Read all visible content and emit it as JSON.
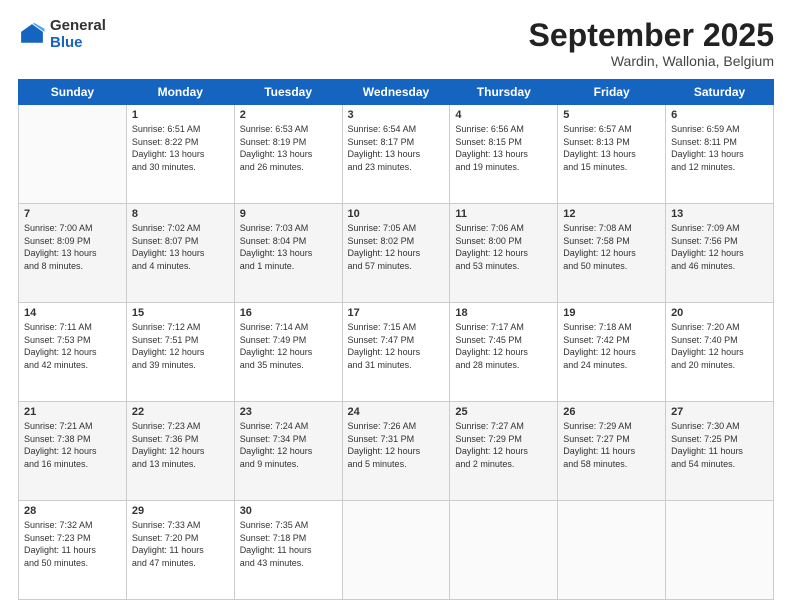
{
  "header": {
    "logo_general": "General",
    "logo_blue": "Blue",
    "month_title": "September 2025",
    "location": "Wardin, Wallonia, Belgium"
  },
  "days_of_week": [
    "Sunday",
    "Monday",
    "Tuesday",
    "Wednesday",
    "Thursday",
    "Friday",
    "Saturday"
  ],
  "weeks": [
    [
      {
        "day": "",
        "info": ""
      },
      {
        "day": "1",
        "info": "Sunrise: 6:51 AM\nSunset: 8:22 PM\nDaylight: 13 hours\nand 30 minutes."
      },
      {
        "day": "2",
        "info": "Sunrise: 6:53 AM\nSunset: 8:19 PM\nDaylight: 13 hours\nand 26 minutes."
      },
      {
        "day": "3",
        "info": "Sunrise: 6:54 AM\nSunset: 8:17 PM\nDaylight: 13 hours\nand 23 minutes."
      },
      {
        "day": "4",
        "info": "Sunrise: 6:56 AM\nSunset: 8:15 PM\nDaylight: 13 hours\nand 19 minutes."
      },
      {
        "day": "5",
        "info": "Sunrise: 6:57 AM\nSunset: 8:13 PM\nDaylight: 13 hours\nand 15 minutes."
      },
      {
        "day": "6",
        "info": "Sunrise: 6:59 AM\nSunset: 8:11 PM\nDaylight: 13 hours\nand 12 minutes."
      }
    ],
    [
      {
        "day": "7",
        "info": "Sunrise: 7:00 AM\nSunset: 8:09 PM\nDaylight: 13 hours\nand 8 minutes."
      },
      {
        "day": "8",
        "info": "Sunrise: 7:02 AM\nSunset: 8:07 PM\nDaylight: 13 hours\nand 4 minutes."
      },
      {
        "day": "9",
        "info": "Sunrise: 7:03 AM\nSunset: 8:04 PM\nDaylight: 13 hours\nand 1 minute."
      },
      {
        "day": "10",
        "info": "Sunrise: 7:05 AM\nSunset: 8:02 PM\nDaylight: 12 hours\nand 57 minutes."
      },
      {
        "day": "11",
        "info": "Sunrise: 7:06 AM\nSunset: 8:00 PM\nDaylight: 12 hours\nand 53 minutes."
      },
      {
        "day": "12",
        "info": "Sunrise: 7:08 AM\nSunset: 7:58 PM\nDaylight: 12 hours\nand 50 minutes."
      },
      {
        "day": "13",
        "info": "Sunrise: 7:09 AM\nSunset: 7:56 PM\nDaylight: 12 hours\nand 46 minutes."
      }
    ],
    [
      {
        "day": "14",
        "info": "Sunrise: 7:11 AM\nSunset: 7:53 PM\nDaylight: 12 hours\nand 42 minutes."
      },
      {
        "day": "15",
        "info": "Sunrise: 7:12 AM\nSunset: 7:51 PM\nDaylight: 12 hours\nand 39 minutes."
      },
      {
        "day": "16",
        "info": "Sunrise: 7:14 AM\nSunset: 7:49 PM\nDaylight: 12 hours\nand 35 minutes."
      },
      {
        "day": "17",
        "info": "Sunrise: 7:15 AM\nSunset: 7:47 PM\nDaylight: 12 hours\nand 31 minutes."
      },
      {
        "day": "18",
        "info": "Sunrise: 7:17 AM\nSunset: 7:45 PM\nDaylight: 12 hours\nand 28 minutes."
      },
      {
        "day": "19",
        "info": "Sunrise: 7:18 AM\nSunset: 7:42 PM\nDaylight: 12 hours\nand 24 minutes."
      },
      {
        "day": "20",
        "info": "Sunrise: 7:20 AM\nSunset: 7:40 PM\nDaylight: 12 hours\nand 20 minutes."
      }
    ],
    [
      {
        "day": "21",
        "info": "Sunrise: 7:21 AM\nSunset: 7:38 PM\nDaylight: 12 hours\nand 16 minutes."
      },
      {
        "day": "22",
        "info": "Sunrise: 7:23 AM\nSunset: 7:36 PM\nDaylight: 12 hours\nand 13 minutes."
      },
      {
        "day": "23",
        "info": "Sunrise: 7:24 AM\nSunset: 7:34 PM\nDaylight: 12 hours\nand 9 minutes."
      },
      {
        "day": "24",
        "info": "Sunrise: 7:26 AM\nSunset: 7:31 PM\nDaylight: 12 hours\nand 5 minutes."
      },
      {
        "day": "25",
        "info": "Sunrise: 7:27 AM\nSunset: 7:29 PM\nDaylight: 12 hours\nand 2 minutes."
      },
      {
        "day": "26",
        "info": "Sunrise: 7:29 AM\nSunset: 7:27 PM\nDaylight: 11 hours\nand 58 minutes."
      },
      {
        "day": "27",
        "info": "Sunrise: 7:30 AM\nSunset: 7:25 PM\nDaylight: 11 hours\nand 54 minutes."
      }
    ],
    [
      {
        "day": "28",
        "info": "Sunrise: 7:32 AM\nSunset: 7:23 PM\nDaylight: 11 hours\nand 50 minutes."
      },
      {
        "day": "29",
        "info": "Sunrise: 7:33 AM\nSunset: 7:20 PM\nDaylight: 11 hours\nand 47 minutes."
      },
      {
        "day": "30",
        "info": "Sunrise: 7:35 AM\nSunset: 7:18 PM\nDaylight: 11 hours\nand 43 minutes."
      },
      {
        "day": "",
        "info": ""
      },
      {
        "day": "",
        "info": ""
      },
      {
        "day": "",
        "info": ""
      },
      {
        "day": "",
        "info": ""
      }
    ]
  ]
}
